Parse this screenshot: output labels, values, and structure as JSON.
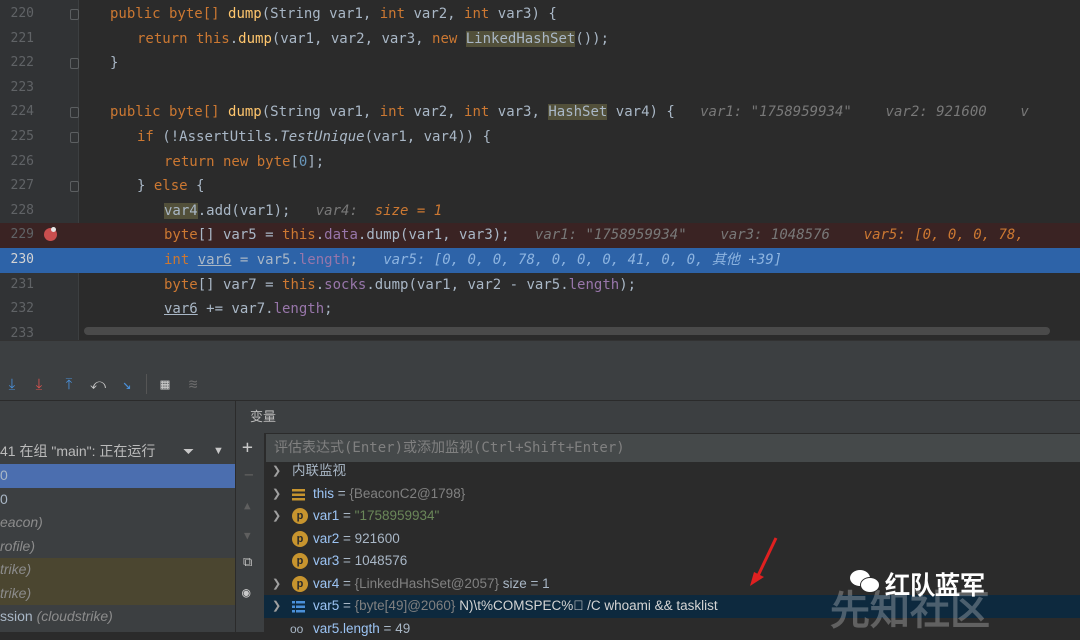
{
  "editor": {
    "lines": [
      {
        "n": "220"
      },
      {
        "n": "221"
      },
      {
        "n": "222"
      },
      {
        "n": "223"
      },
      {
        "n": "224"
      },
      {
        "n": "225"
      },
      {
        "n": "226"
      },
      {
        "n": "227"
      },
      {
        "n": "228"
      },
      {
        "n": "229"
      },
      {
        "n": "230"
      },
      {
        "n": "231"
      },
      {
        "n": "232"
      },
      {
        "n": "233"
      }
    ],
    "code": {
      "l220": {
        "a": "public byte[] ",
        "b": "dump",
        "c": "(String var1, ",
        "d": "int ",
        "e": "var2, ",
        "f": "int ",
        "g": "var3) {"
      },
      "l221": {
        "a": "return this",
        "b": ".",
        "c": "dump",
        "d": "(var1, var2, var3, ",
        "e": "new ",
        "f": "LinkedHashSet",
        "g": "());"
      },
      "l222": {
        "a": "}"
      },
      "l224": {
        "a": "public byte[] ",
        "b": "dump",
        "c": "(String var1, ",
        "d": "int ",
        "e": "var2, ",
        "f": "int ",
        "g": "var3, ",
        "h": "HashSet",
        "i": " var4) {",
        "j": "var1: \"1758959934\"",
        "k": "var2: 921600",
        "l": "v"
      },
      "l225": {
        "a": "if ",
        "b": "(!AssertUtils.",
        "c": "TestUnique",
        "d": "(var1, var4)) {"
      },
      "l226": {
        "a": "return new ",
        "b": "byte",
        "c": "[",
        "d": "0",
        "e": "];"
      },
      "l227": {
        "a": "} ",
        "b": "else ",
        "c": "{"
      },
      "l228": {
        "a": "var4",
        "b": ".add(var1);",
        "c": "var4:",
        "d": "size = 1"
      },
      "l229": {
        "a": "byte",
        "b": "[] var5 = ",
        "c": "this",
        "d": ".",
        "e": "data",
        "f": ".dump(var1, var3);",
        "g": "var1: \"1758959934\"",
        "h": "var3: 1048576",
        "i": "var5: [0, 0, 0, 78,"
      },
      "l230": {
        "a": "int ",
        "b": "var6",
        "c": " = var5.",
        "d": "length",
        "e": ";",
        "f": "var5: [0, 0, 0, 78, 0, 0, 0, 41, 0, 0, 其他 +39]"
      },
      "l231": {
        "a": "byte",
        "b": "[] var7 = ",
        "c": "this",
        "d": ".",
        "e": "socks",
        "f": ".dump(var1, var2 - var5.",
        "g": "length",
        "h": ");"
      },
      "l232": {
        "a": "var6",
        "b": " += var7.",
        "c": "length",
        "d": ";"
      }
    }
  },
  "debug": {
    "thread_label": "41 在组 \"main\": 正在运行",
    "frames": [
      {
        "a": "0",
        "b": ""
      },
      {
        "a": "0",
        "b": ""
      },
      {
        "a": "",
        "b": "eacon)"
      },
      {
        "a": "",
        "b": "rofile)"
      },
      {
        "a": "",
        "b": "trike)"
      },
      {
        "a": "",
        "b": "trike)"
      },
      {
        "a": "ssion ",
        "b": "(cloudstrike)"
      }
    ],
    "variables_title": "变量",
    "eval_placeholder": "评估表达式(Enter)或添加监视(Ctrl+Shift+Enter)",
    "vars": [
      {
        "name": "内联监视",
        "eq": "",
        "val": "",
        "extra": ""
      },
      {
        "name": "this",
        "eq": " = ",
        "val": "{BeaconC2@1798}",
        "extra": ""
      },
      {
        "name": "var1",
        "eq": " = ",
        "val": "\"1758959934\"",
        "extra": ""
      },
      {
        "name": "var2",
        "eq": " = ",
        "val": "921600",
        "extra": ""
      },
      {
        "name": "var3",
        "eq": " = ",
        "val": "1048576",
        "extra": ""
      },
      {
        "name": "var4",
        "eq": " = ",
        "val": "{LinkedHashSet@2057}",
        "extra": " size = 1"
      },
      {
        "name": "var5",
        "eq": " = ",
        "val": "{byte[49]@2060}",
        "extra": " N)\\t%COMSPEC%\u0000 /C whoami && tasklist"
      },
      {
        "name": "var5.length",
        "eq": " = ",
        "val": "49",
        "extra": ""
      }
    ]
  },
  "watermark": {
    "brand": "红队蓝军",
    "site": "先知社区"
  }
}
